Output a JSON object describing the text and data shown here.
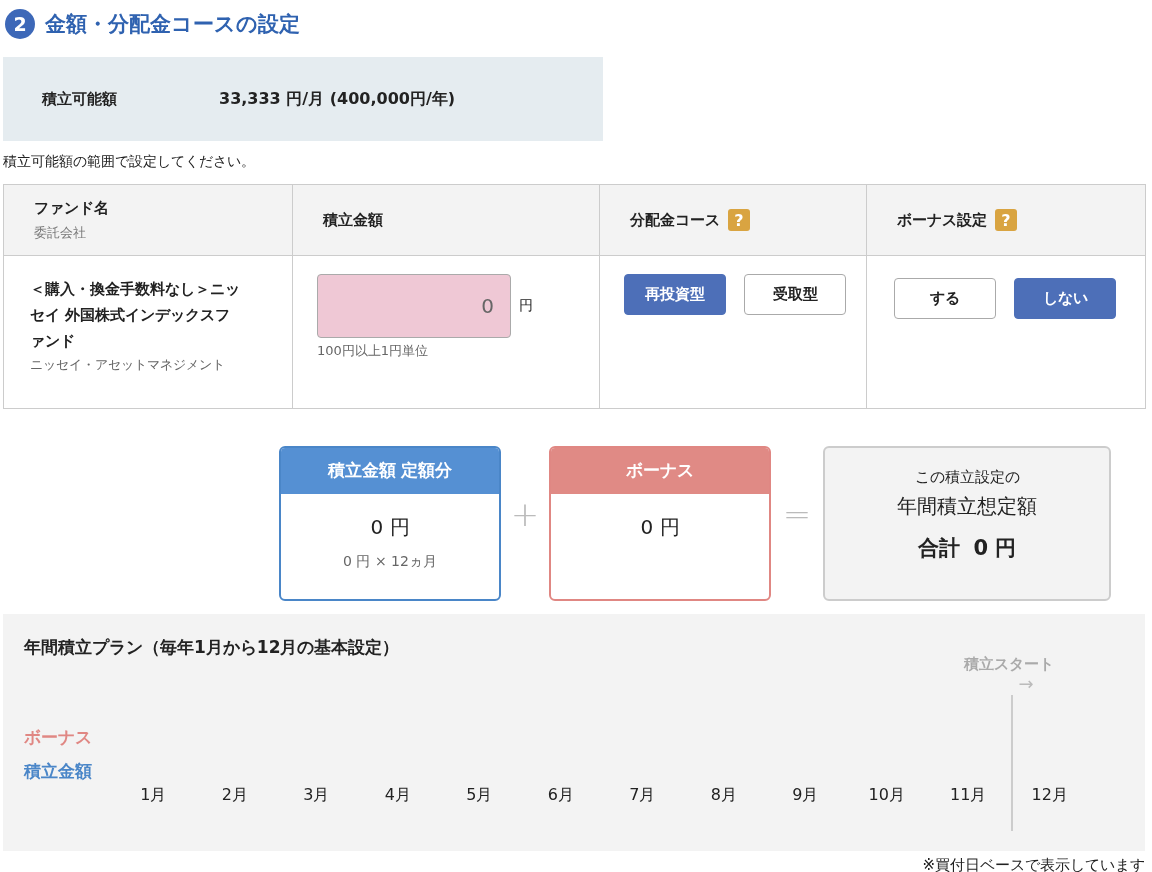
{
  "section": {
    "number": "2",
    "title": "金額・分配金コースの設定"
  },
  "available": {
    "label": "積立可能額",
    "value": "33,333 円/月 (400,000円/年)"
  },
  "note": "積立可能額の範囲で設定してください。",
  "table": {
    "columns": [
      {
        "label": "ファンド名",
        "sub": "委託会社"
      },
      {
        "label": "積立金額"
      },
      {
        "label": "分配金コース",
        "help": "?"
      },
      {
        "label": "ボーナス設定",
        "help": "?"
      }
    ],
    "rows": [
      {
        "fund_name": "＜購入・換金手数料なし＞ニッセイ 外国株式インデックスファンド",
        "company": "ニッセイ・アセットマネジメント",
        "amount": {
          "value": "0",
          "unit": "円",
          "hint": "100円以上1円単位"
        },
        "course_options": [
          {
            "label": "再投資型",
            "selected": true
          },
          {
            "label": "受取型",
            "selected": false
          }
        ],
        "bonus_options": [
          {
            "label": "する",
            "selected": false
          },
          {
            "label": "しない",
            "selected": true
          }
        ]
      }
    ]
  },
  "summary": {
    "monthly": {
      "title": "積立金額 定額分",
      "amount": "0 円",
      "detail": "0 円 × 12ヵ月"
    },
    "plus": "+",
    "bonus": {
      "title": "ボーナス",
      "amount": "0 円"
    },
    "equals": "=",
    "total": {
      "caption": "この積立設定の",
      "title": "年間積立想定額",
      "label": "合計",
      "amount": "0 円"
    }
  },
  "plan": {
    "title": "年間積立プラン（毎年1月から12月の基本設定）",
    "start_label": "積立スタート",
    "arrow": "→",
    "legend": [
      {
        "label": "ボーナス",
        "color": "#e08783"
      },
      {
        "label": "積立金額",
        "color": "#4a86c8"
      }
    ],
    "months": [
      {
        "label": "1月",
        "start": false
      },
      {
        "label": "2月",
        "start": false
      },
      {
        "label": "3月",
        "start": false
      },
      {
        "label": "4月",
        "start": false
      },
      {
        "label": "5月",
        "start": false
      },
      {
        "label": "6月",
        "start": false
      },
      {
        "label": "7月",
        "start": false
      },
      {
        "label": "8月",
        "start": false
      },
      {
        "label": "9月",
        "start": false
      },
      {
        "label": "10月",
        "start": false
      },
      {
        "label": "11月",
        "start": false
      },
      {
        "label": "12月",
        "start": true
      }
    ]
  },
  "footnote": "※買付日ベースで表示しています"
}
